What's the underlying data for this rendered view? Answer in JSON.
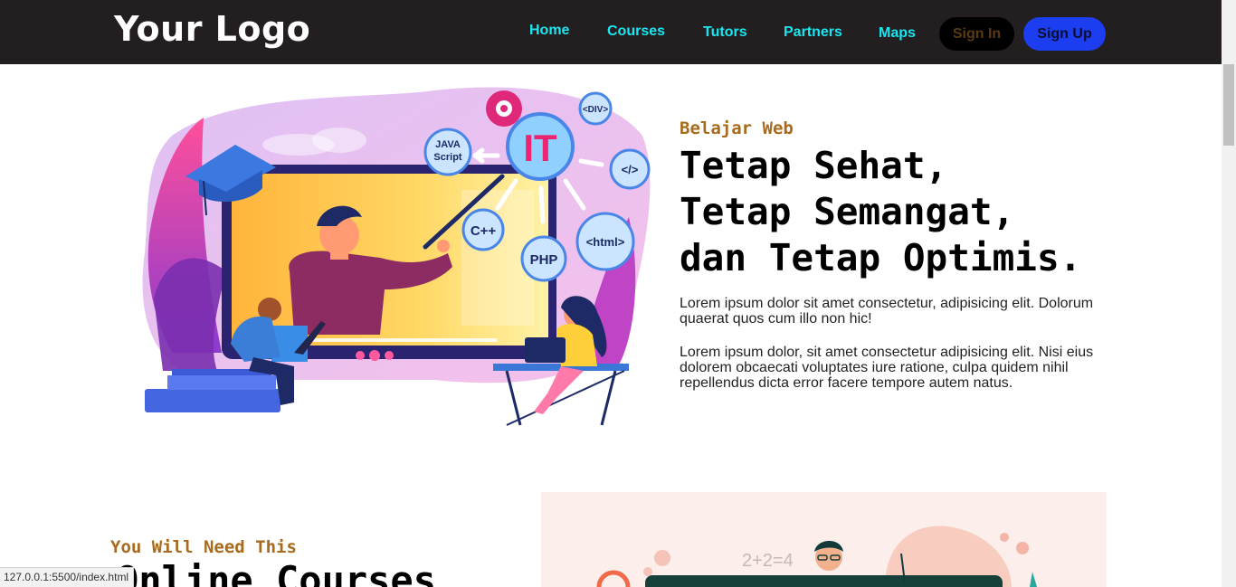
{
  "header": {
    "logo": "Your Logo",
    "nav": [
      "Home",
      "Courses",
      "Tutors",
      "Partners",
      "Maps"
    ],
    "signin": "Sign In",
    "signup": "Sign Up"
  },
  "hero": {
    "eyebrow": "Belajar Web",
    "title_lines": [
      "Tetap Sehat,",
      "Tetap Semangat,",
      "dan Tetap Optimis."
    ],
    "paragraphs": [
      "Lorem ipsum dolor sit amet consectetur, adipisicing elit. Dolorum quaerat quos cum illo non hic!",
      "Lorem ipsum dolor, sit amet consectetur adipisicing elit. Nisi eius dolorem obcaecati voluptates iure ratione, culpa quidem nihil repellendus dicta error facere tempore autem natus."
    ],
    "illustration": {
      "badges": [
        "IT",
        "JAVA",
        "Script",
        "<DIV>",
        "</>",
        "C++",
        "PHP",
        "<html>"
      ]
    }
  },
  "courses": {
    "eyebrow": "You Will Need This",
    "title": "Online Courses",
    "illustration": {
      "board_text": "2+2=4"
    }
  },
  "status_bar": {
    "url": "127.0.0.1:5500/index.html"
  },
  "colors": {
    "navbar": "#231f20",
    "nav_link": "#18e6f0",
    "accent_brown": "#a86a1c",
    "signup": "#1c3ef0"
  }
}
